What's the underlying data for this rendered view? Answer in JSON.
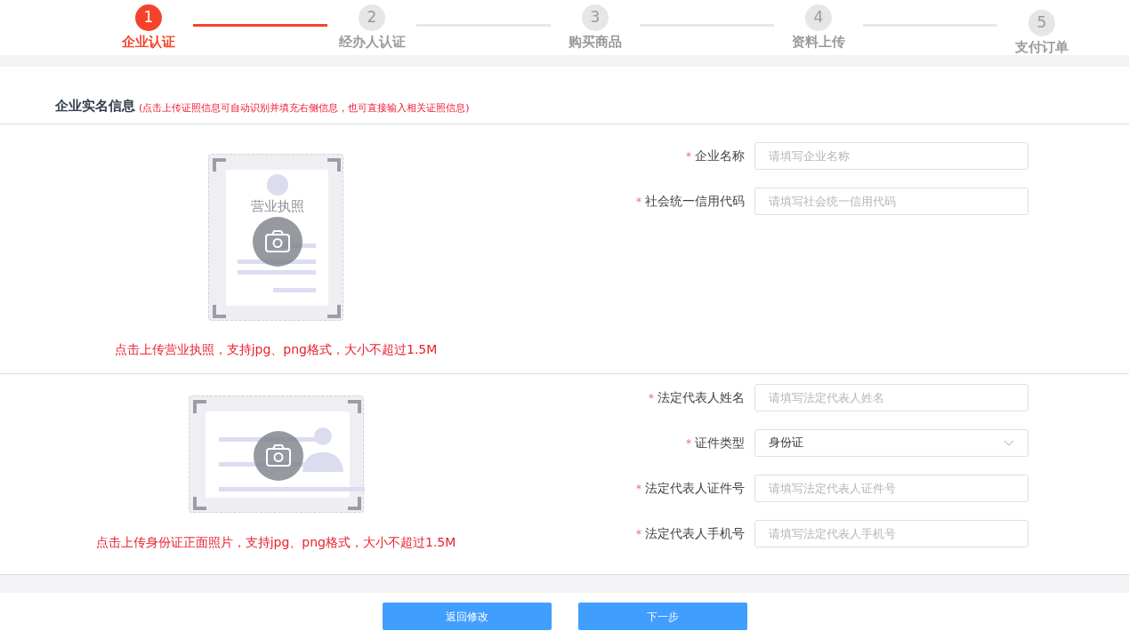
{
  "steps": [
    {
      "number": "1",
      "label": "企业认证",
      "selected": true
    },
    {
      "number": "2",
      "label": "经办人认证",
      "selected": false
    },
    {
      "number": "3",
      "label": "购买商品",
      "selected": false
    },
    {
      "number": "4",
      "label": "资料上传",
      "selected": false
    },
    {
      "number": "5",
      "label": "支付订单",
      "selected": false
    }
  ],
  "section": {
    "title": "企业实名信息",
    "note": "(点击上传证照信息可自动识别并填充右侧信息，也可直接输入相关证照信息)"
  },
  "groups": [
    {
      "upload": {
        "kind": "license",
        "card_title": "营业执照",
        "hint": "点击上传营业执照，支持jpg、png格式，大小不超过1.5M"
      },
      "fields": [
        {
          "kind": "text",
          "required_mark": "*",
          "label": "企业名称",
          "placeholder": "请填写企业名称"
        },
        {
          "kind": "text",
          "required_mark": "*",
          "label": "社会统一信用代码",
          "placeholder": "请填写社会统一信用代码"
        }
      ]
    },
    {
      "upload": {
        "kind": "idcard",
        "hint": "点击上传身份证正面照片，支持jpg、png格式，大小不超过1.5M"
      },
      "fields": [
        {
          "kind": "text",
          "required_mark": "*",
          "label": "法定代表人姓名",
          "placeholder": "请填写法定代表人姓名"
        },
        {
          "kind": "select",
          "required_mark": "*",
          "label": "证件类型",
          "value": "身份证"
        },
        {
          "kind": "text",
          "required_mark": "*",
          "label": "法定代表人证件号",
          "placeholder": "请填写法定代表人证件号"
        },
        {
          "kind": "text",
          "required_mark": "*",
          "label": "法定代表人手机号",
          "placeholder": "请填写法定代表人手机号"
        }
      ]
    }
  ],
  "buttons": [
    "返回修改",
    "下一步"
  ]
}
